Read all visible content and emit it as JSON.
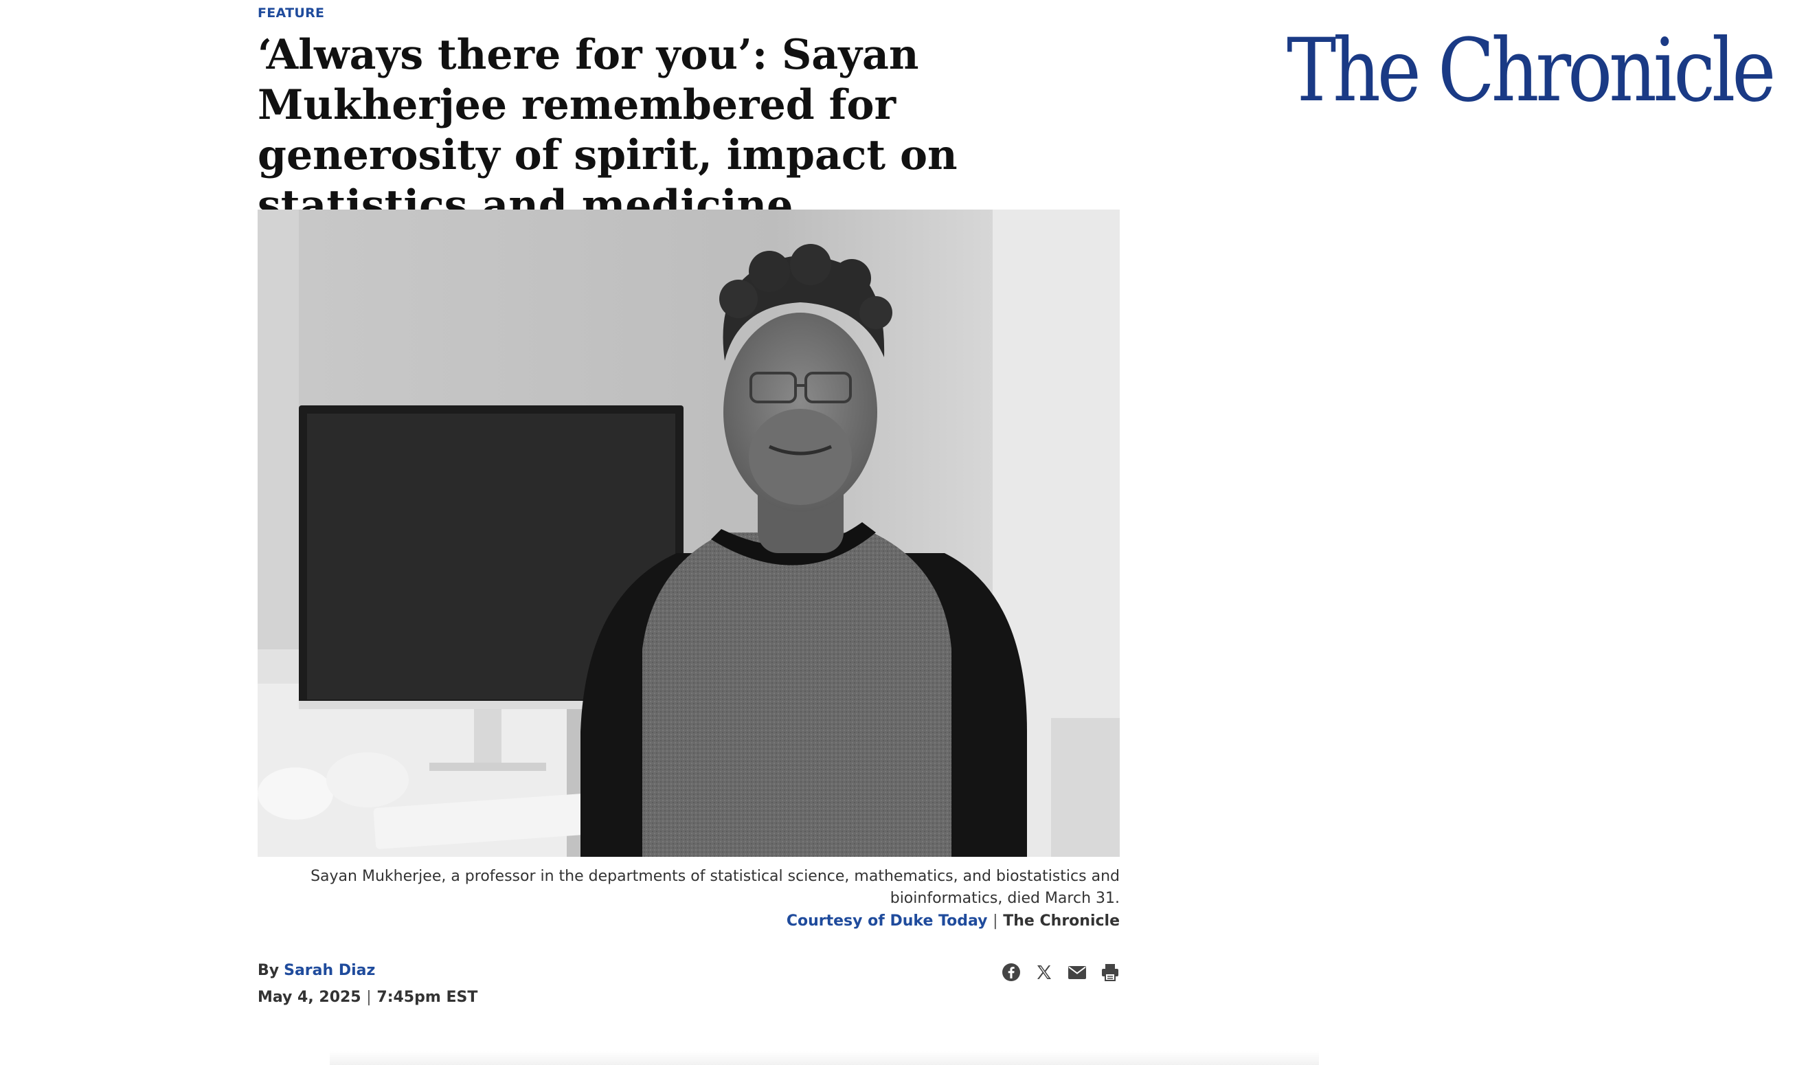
{
  "article": {
    "kicker": "FEATURE",
    "headline": "‘Always there for you’: Sayan Mukherjee remembered for generosity of spirit, impact on statistics and medicine",
    "caption": "Sayan Mukherjee, a professor in the departments of statistical science, mathematics, and biostatistics and bioinformatics, died March 31.",
    "credit": {
      "source": "Courtesy of Duke Today",
      "separator": "|",
      "publication": "The Chronicle"
    },
    "byline": {
      "prefix": "By",
      "author": "Sarah Diaz"
    },
    "date": {
      "day": "May 4, 2025",
      "separator": "|",
      "time": "7:45pm EST"
    },
    "share": [
      {
        "icon": "facebook-icon"
      },
      {
        "icon": "x-icon"
      },
      {
        "icon": "email-icon"
      },
      {
        "icon": "print-icon"
      }
    ]
  },
  "masthead": {
    "logo_text": "The Chronicle"
  },
  "colors": {
    "brand_blue": "#1f4b9c",
    "logo_blue": "#1a3a85",
    "text": "#111111",
    "caption": "#333333"
  }
}
